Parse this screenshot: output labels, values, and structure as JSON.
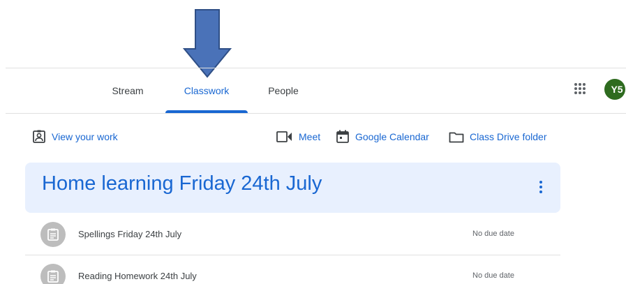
{
  "nav": {
    "tabs": [
      {
        "label": "Stream",
        "active": false
      },
      {
        "label": "Classwork",
        "active": true
      },
      {
        "label": "People",
        "active": false
      }
    ],
    "apps_icon": "grid-apps-icon",
    "avatar_initials": "Y5",
    "avatar_color": "#2e6b1f"
  },
  "annotation": {
    "arrow_icon": "down-arrow-icon",
    "arrow_color": "#4a72b8"
  },
  "actions": {
    "view_work": "View your work",
    "meet": "Meet",
    "calendar": "Google Calendar",
    "drive": "Class Drive folder"
  },
  "topic": {
    "title": "Home learning Friday 24th July"
  },
  "items": [
    {
      "title": "Spellings Friday 24th July",
      "due": "No due date"
    },
    {
      "title": "Reading Homework 24th July",
      "due": "No due date"
    }
  ],
  "colors": {
    "accent": "#1967d2",
    "topic_bg": "#e8f0fe"
  }
}
